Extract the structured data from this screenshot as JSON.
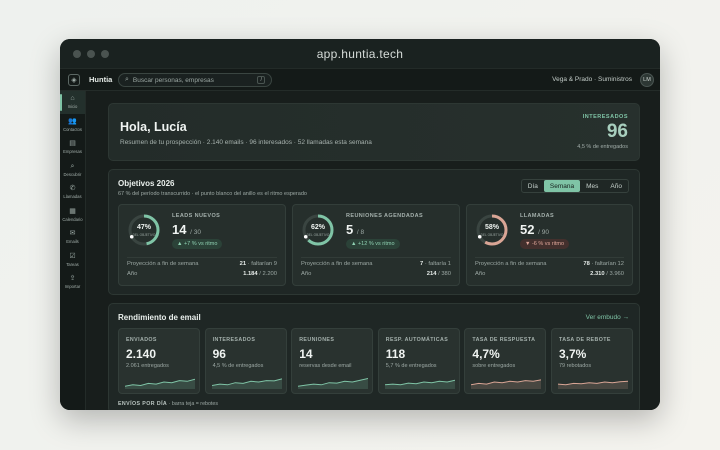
{
  "window": {
    "url": "app.huntia.tech"
  },
  "appbar": {
    "brand": "Huntia",
    "search_placeholder": "Buscar personas, empresas",
    "search_shortcut": "/",
    "company": "Vega & Prado · Suministros",
    "avatar_initials": "LM"
  },
  "sidebar": {
    "items": [
      {
        "label": "Inicio",
        "icon": "home-icon",
        "glyph": "⌂"
      },
      {
        "label": "Contactos",
        "icon": "users-icon",
        "glyph": "👥"
      },
      {
        "label": "Empresas",
        "icon": "building-icon",
        "glyph": "▤"
      },
      {
        "label": "Descubrir",
        "icon": "search-icon",
        "glyph": "⌕"
      },
      {
        "label": "Llamadas",
        "icon": "phone-icon",
        "glyph": "✆"
      },
      {
        "label": "Calendario",
        "icon": "calendar-icon",
        "glyph": "▦"
      },
      {
        "label": "Emails",
        "icon": "mail-icon",
        "glyph": "✉"
      },
      {
        "label": "Tareas",
        "icon": "checkbox-icon",
        "glyph": "☑"
      },
      {
        "label": "Importar",
        "icon": "upload-icon",
        "glyph": "⇪"
      }
    ]
  },
  "hero": {
    "title": "Hola, Lucía",
    "subtitle": "Resumen de tu prospección · 2.140 emails · 96 interesados · 52 llamadas esta semana",
    "stat_label": "INTERESADOS",
    "stat_value": "96",
    "stat_note": "4,5 % de entregados"
  },
  "objectives": {
    "title": "Objetivos 2026",
    "subtitle": "67 % del período transcurrido · el punto blanco del anillo es el ritmo esperado",
    "periods": [
      "Día",
      "Semana",
      "Mes",
      "Año"
    ],
    "active_period": "Semana",
    "goals": [
      {
        "label": "LEADS NUEVOS",
        "value": "14",
        "target": "/ 30",
        "pct": "47%",
        "pct_value": 0.47,
        "pace": 0.67,
        "ring_caption": "DEL OBJETIVO",
        "trend": "▲ +7 % vs ritmo",
        "trend_dir": "up",
        "row1_label": "Proyección a fin de semana",
        "row1_value": "21",
        "row1_rest": "· faltarían 9",
        "row2_label": "Año",
        "row2_value": "1.184",
        "row2_rest": "/ 2.200",
        "ring_color": "#7fc4a6"
      },
      {
        "label": "REUNIONES AGENDADAS",
        "value": "5",
        "target": "/ 8",
        "pct": "62%",
        "pct_value": 0.62,
        "pace": 0.67,
        "ring_caption": "DEL OBJETIVO",
        "trend": "▲ +12 % vs ritmo",
        "trend_dir": "up",
        "row1_label": "Proyección a fin de semana",
        "row1_value": "7",
        "row1_rest": "· faltaría 1",
        "row2_label": "Año",
        "row2_value": "214",
        "row2_rest": "/ 380",
        "ring_color": "#7fc4a6"
      },
      {
        "label": "LLAMADAS",
        "value": "52",
        "target": "/ 90",
        "pct": "58%",
        "pct_value": 0.58,
        "pace": 0.67,
        "ring_caption": "DEL OBJETIVO",
        "trend": "▼ -6 % vs ritmo",
        "trend_dir": "down",
        "row1_label": "Proyección a fin de semana",
        "row1_value": "78",
        "row1_rest": "· faltarían 12",
        "row2_label": "Año",
        "row2_value": "2.310",
        "row2_rest": "/ 3.960",
        "ring_color": "#d9a595"
      }
    ]
  },
  "email": {
    "title": "Rendimiento de email",
    "link": "Ver embudo →",
    "footer_label": "ENVÍOS POR DÍA",
    "footer_note": "· barra teja = rebotes",
    "metrics": [
      {
        "label": "ENVIADOS",
        "value": "2.140",
        "sub": "2.061 entregados",
        "color": "#7fc4a6",
        "trend": [
          0.2,
          0.3,
          0.25,
          0.4,
          0.35,
          0.5,
          0.45,
          0.6,
          0.55,
          0.7
        ]
      },
      {
        "label": "INTERESADOS",
        "value": "96",
        "sub": "4,5 % de entregados",
        "color": "#7fc4a6",
        "trend": [
          0.25,
          0.35,
          0.3,
          0.45,
          0.4,
          0.55,
          0.5,
          0.6,
          0.58,
          0.72
        ]
      },
      {
        "label": "REUNIONES",
        "value": "14",
        "sub": "reservas desde email",
        "color": "#7fc4a6",
        "trend": [
          0.2,
          0.28,
          0.35,
          0.3,
          0.45,
          0.42,
          0.55,
          0.5,
          0.62,
          0.75
        ]
      },
      {
        "label": "RESP. AUTOMÁTICAS",
        "value": "118",
        "sub": "5,7 % de entregados",
        "color": "#7fc4a6",
        "trend": [
          0.3,
          0.35,
          0.3,
          0.42,
          0.38,
          0.5,
          0.45,
          0.55,
          0.5,
          0.62
        ]
      },
      {
        "label": "TASA DE RESPUESTA",
        "value": "4,7%",
        "sub": "sobre entregados",
        "color": "#d9a595",
        "trend": [
          0.3,
          0.4,
          0.35,
          0.5,
          0.45,
          0.55,
          0.5,
          0.6,
          0.55,
          0.65
        ]
      },
      {
        "label": "TASA DE REBOTE",
        "value": "3,7%",
        "sub": "79 rebotados",
        "color": "#d9a595",
        "trend": [
          0.35,
          0.3,
          0.4,
          0.38,
          0.45,
          0.4,
          0.5,
          0.45,
          0.52,
          0.55
        ]
      }
    ]
  }
}
